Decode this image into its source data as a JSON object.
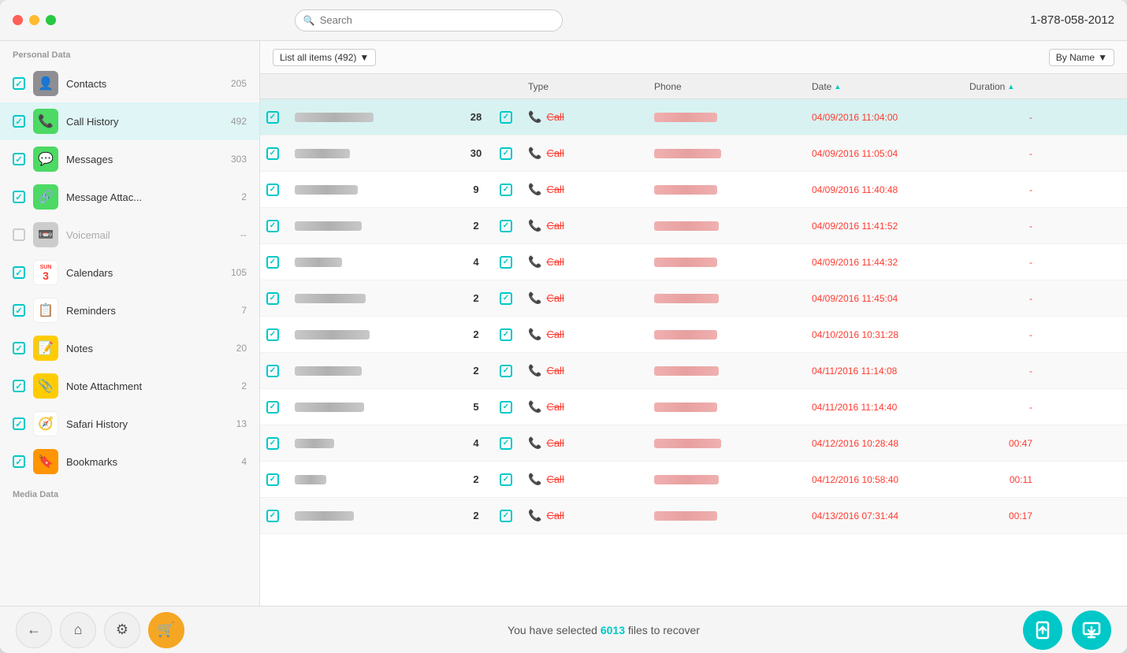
{
  "titlebar": {
    "search_placeholder": "Search",
    "phone_number": "1-878-058-2012"
  },
  "sidebar": {
    "personal_label": "Personal Data",
    "media_label": "Media Data",
    "items": [
      {
        "id": "contacts",
        "name": "Contacts",
        "count": "205",
        "checked": true,
        "icon": "👤",
        "icon_class": "icon-contacts",
        "active": false
      },
      {
        "id": "call-history",
        "name": "Call History",
        "count": "492",
        "checked": true,
        "icon": "📞",
        "icon_class": "icon-callhistory",
        "active": true
      },
      {
        "id": "messages",
        "name": "Messages",
        "count": "303",
        "checked": true,
        "icon": "💬",
        "icon_class": "icon-messages",
        "active": false
      },
      {
        "id": "message-attach",
        "name": "Message Attac...",
        "count": "2",
        "checked": true,
        "icon": "🔗",
        "icon_class": "icon-msgattach",
        "active": false
      },
      {
        "id": "voicemail",
        "name": "Voicemail",
        "count": "--",
        "checked": false,
        "icon": "📼",
        "icon_class": "icon-voicemail",
        "active": false,
        "dimmed": true
      },
      {
        "id": "calendars",
        "name": "Calendars",
        "count": "105",
        "checked": true,
        "icon": "3",
        "icon_class": "icon-calendars",
        "active": false
      },
      {
        "id": "reminders",
        "name": "Reminders",
        "count": "7",
        "checked": true,
        "icon": "📋",
        "icon_class": "icon-reminders",
        "active": false
      },
      {
        "id": "notes",
        "name": "Notes",
        "count": "20",
        "checked": true,
        "icon": "📝",
        "icon_class": "icon-notes",
        "active": false
      },
      {
        "id": "note-attach",
        "name": "Note Attachment",
        "count": "2",
        "checked": true,
        "icon": "📎",
        "icon_class": "icon-noteattach",
        "active": false
      },
      {
        "id": "safari",
        "name": "Safari History",
        "count": "13",
        "checked": true,
        "icon": "🧭",
        "icon_class": "icon-safari",
        "active": false
      },
      {
        "id": "bookmarks",
        "name": "Bookmarks",
        "count": "4",
        "checked": true,
        "icon": "🔖",
        "icon_class": "icon-bookmarks",
        "active": false
      }
    ]
  },
  "toolbar": {
    "list_filter": "List all items (492)",
    "by_name": "By Name"
  },
  "table": {
    "columns": [
      {
        "id": "check",
        "label": ""
      },
      {
        "id": "name",
        "label": ""
      },
      {
        "id": "count",
        "label": ""
      },
      {
        "id": "row-check",
        "label": ""
      },
      {
        "id": "type",
        "label": "Type"
      },
      {
        "id": "phone",
        "label": "Phone"
      },
      {
        "id": "date",
        "label": "Date"
      },
      {
        "id": "duration",
        "label": "Duration"
      }
    ],
    "rows": [
      {
        "count": "28",
        "type": "Call",
        "date": "04/09/2016 11:04:00",
        "duration": "-",
        "name_width": 100,
        "phone_width": 80,
        "selected": true
      },
      {
        "count": "30",
        "type": "Call",
        "date": "04/09/2016 11:05:04",
        "duration": "-",
        "name_width": 70,
        "phone_width": 85
      },
      {
        "count": "9",
        "type": "Call",
        "date": "04/09/2016 11:40:48",
        "duration": "-",
        "name_width": 80,
        "phone_width": 80
      },
      {
        "count": "2",
        "type": "Call",
        "date": "04/09/2016 11:41:52",
        "duration": "-",
        "name_width": 85,
        "phone_width": 82
      },
      {
        "count": "4",
        "type": "Call",
        "date": "04/09/2016 11:44:32",
        "duration": "-",
        "name_width": 60,
        "phone_width": 80
      },
      {
        "count": "2",
        "type": "Call",
        "date": "04/09/2016 11:45:04",
        "duration": "-",
        "name_width": 90,
        "phone_width": 82
      },
      {
        "count": "2",
        "type": "Call",
        "date": "04/10/2016 10:31:28",
        "duration": "-",
        "name_width": 95,
        "phone_width": 80
      },
      {
        "count": "2",
        "type": "Call",
        "date": "04/11/2016 11:14:08",
        "duration": "-",
        "name_width": 85,
        "phone_width": 82
      },
      {
        "count": "5",
        "type": "Call",
        "date": "04/11/2016 11:14:40",
        "duration": "-",
        "name_width": 88,
        "phone_width": 80
      },
      {
        "count": "4",
        "type": "Call",
        "date": "04/12/2016 10:28:48",
        "duration": "00:47",
        "name_width": 50,
        "phone_width": 85
      },
      {
        "count": "2",
        "type": "Call",
        "date": "04/12/2016 10:58:40",
        "duration": "00:11",
        "name_width": 40,
        "phone_width": 82
      },
      {
        "count": "2",
        "type": "Call",
        "date": "04/13/2016 07:31:44",
        "duration": "00:17",
        "name_width": 75,
        "phone_width": 80
      }
    ]
  },
  "bottom_bar": {
    "text_before": "You have selected ",
    "count": "6013",
    "text_after": " files to recover"
  },
  "nav": {
    "back_label": "←",
    "home_label": "⌂",
    "settings_label": "⚙",
    "cart_label": "🛒"
  },
  "actions": {
    "recover1_label": "↗",
    "recover2_label": "⬇"
  }
}
